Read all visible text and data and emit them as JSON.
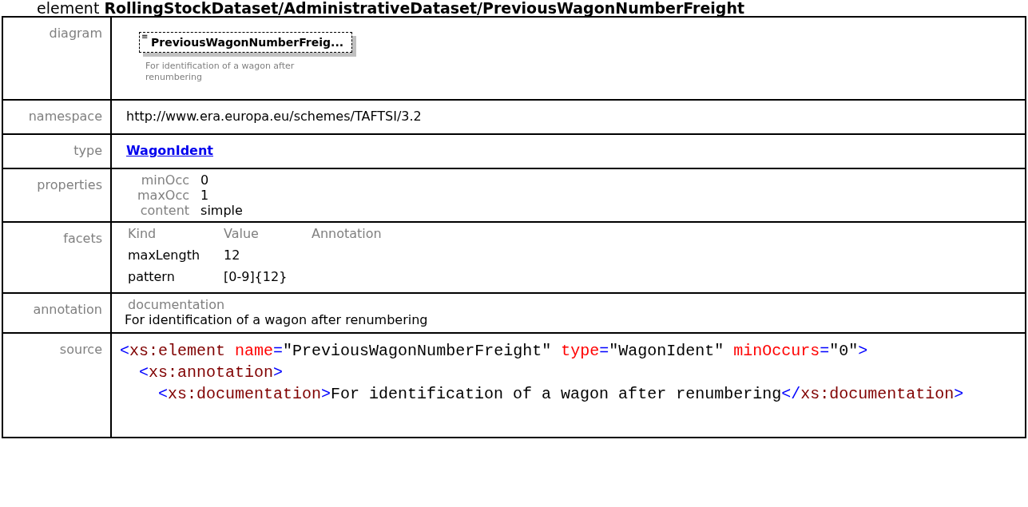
{
  "title": {
    "prefix": "element",
    "path": "RollingStockDataset/AdministrativeDataset/PreviousWagonNumberFreight"
  },
  "diagram": {
    "label": "diagram",
    "icon": "≡",
    "name": "PreviousWagonNumberFreig...",
    "description": "For identification of a wagon after renumbering",
    "optional": true
  },
  "namespace": {
    "label": "namespace",
    "value": "http://www.era.europa.eu/schemes/TAFTSI/3.2"
  },
  "type": {
    "label": "type",
    "value": "WagonIdent"
  },
  "properties": {
    "label": "properties",
    "items": [
      {
        "name": "minOcc",
        "value": "0"
      },
      {
        "name": "maxOcc",
        "value": "1"
      },
      {
        "name": "content",
        "value": "simple"
      }
    ]
  },
  "facets": {
    "label": "facets",
    "columns": [
      "Kind",
      "Value",
      "Annotation"
    ],
    "rows": [
      {
        "kind": "maxLength",
        "value": "12"
      },
      {
        "kind": "pattern",
        "value": "[0-9]{12}"
      }
    ]
  },
  "annotation": {
    "label": "annotation",
    "heading": "documentation",
    "text": "For identification of a wagon after renumbering"
  },
  "source": {
    "label": "source",
    "code": {
      "tokens": [
        {
          "kind": "bracket",
          "text": "<"
        },
        {
          "kind": "tag",
          "text": "xs:element"
        },
        {
          "kind": "attr",
          "text": "name"
        },
        {
          "kind": "bracket",
          "text": "="
        },
        {
          "kind": "text",
          "text": "\"PreviousWagonNumberFreight\""
        },
        {
          "kind": "attr",
          "text": "type"
        },
        {
          "kind": "bracket",
          "text": "="
        },
        {
          "kind": "text",
          "text": "\"WagonIdent\""
        },
        {
          "kind": "attr",
          "text": "minOccurs"
        },
        {
          "kind": "bracket",
          "text": "="
        },
        {
          "kind": "text",
          "text": "\"0\""
        },
        {
          "kind": "bracket",
          "text": ">"
        }
      ],
      "children": [
        {
          "tokens": [
            {
              "kind": "bracket",
              "text": "<"
            },
            {
              "kind": "tag",
              "text": "xs:annotation"
            },
            {
              "kind": "bracket",
              "text": ">"
            }
          ],
          "children": [
            {
              "tokens": [
                {
                  "kind": "bracket",
                  "text": "<"
                },
                {
                  "kind": "tag",
                  "text": "xs:documentation"
                },
                {
                  "kind": "bracket",
                  "text": ">"
                },
                {
                  "kind": "text",
                  "text": "For identification of a wagon after renumbering"
                },
                {
                  "kind": "bracket",
                  "text": "</"
                },
                {
                  "kind": "tag",
                  "text": "xs:documentation"
                },
                {
                  "kind": "bracket",
                  "text": ">"
                }
              ]
            }
          ]
        }
      ]
    }
  }
}
